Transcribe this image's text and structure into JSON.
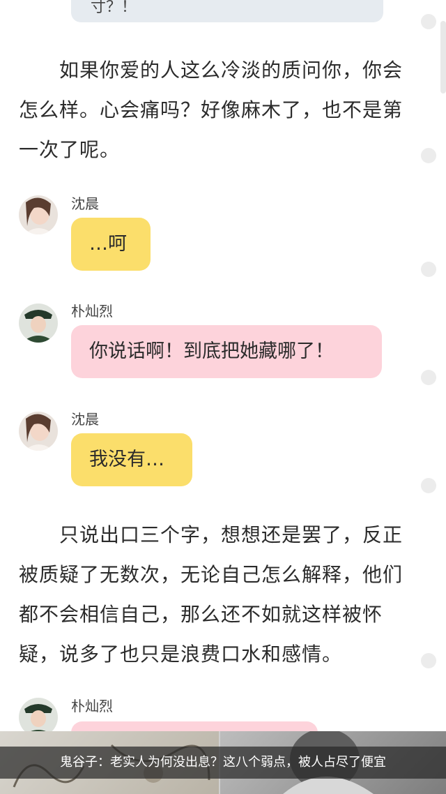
{
  "top_bubble_fragment": "寸？！",
  "paragraphs": [
    "　　如果你爱的人这么冷淡的质问你，你会怎么样。心会痛吗？好像麻木了，也不是第一次了呢。",
    "　　只说出口三个字，想想还是罢了，反正被质疑了无数次，无论自己怎么解释，他们都不会相信自己，那么还不如就这样被怀疑，说多了也只是浪费口水和感情。"
  ],
  "messages": [
    {
      "sender": "沈晨",
      "text": "…呵",
      "color": "yellow"
    },
    {
      "sender": "朴灿烈",
      "text": "你说话啊！到底把她藏哪了！",
      "color": "pink"
    },
    {
      "sender": "沈晨",
      "text": "我没有…",
      "color": "yellow"
    },
    {
      "sender": "朴灿烈",
      "text": "",
      "color": "pink"
    }
  ],
  "ad": {
    "caption": "鬼谷子：老实人为何没出息？这八个弱点，被人占尽了便宜"
  },
  "colors": {
    "yellow_bubble": "#fbde6b",
    "pink_bubble": "#fdd3db",
    "gray_bubble": "#e6ebf0"
  }
}
